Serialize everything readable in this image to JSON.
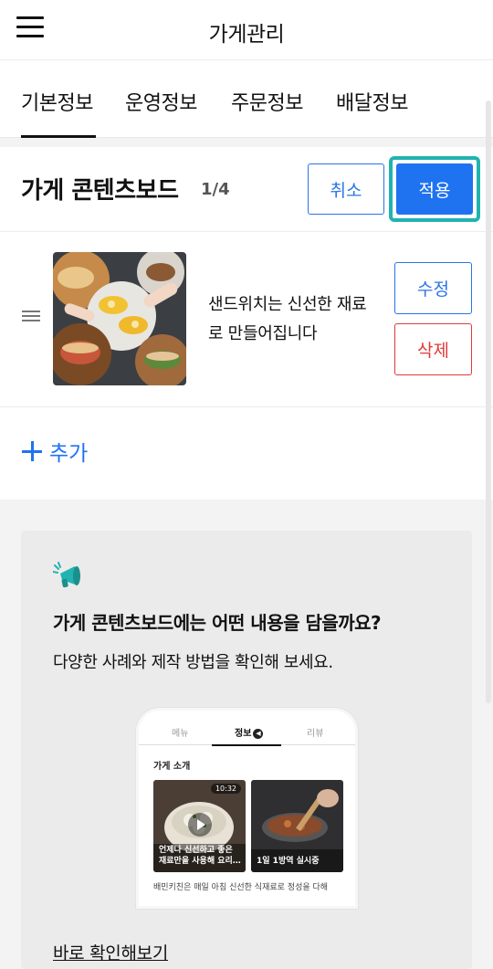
{
  "header": {
    "title": "가게관리",
    "menu_icon": "hamburger-menu-icon"
  },
  "tabs": [
    {
      "label": "기본정보",
      "active": true
    },
    {
      "label": "운영정보",
      "active": false
    },
    {
      "label": "주문정보",
      "active": false
    },
    {
      "label": "배달정보",
      "active": false
    }
  ],
  "board": {
    "title": "가게 콘텐츠보드",
    "count": "1/4",
    "cancel_label": "취소",
    "apply_label": "적용",
    "items": [
      {
        "text": "샌드위치는 신선한 재료로 만들어집니다",
        "edit_label": "수정",
        "delete_label": "삭제"
      }
    ],
    "add_label": "추가"
  },
  "guide": {
    "title": "가게 콘텐츠보드에는 어떤 내용을 담을까요?",
    "subtitle": "다양한 사례와 제작 방법을 확인해 보세요.",
    "link": "바로 확인해보기",
    "preview": {
      "tabs": [
        "메뉴",
        "정보",
        "리뷰"
      ],
      "section": "가게 소개",
      "card1_text": "언제나 신선하고 좋은 재료만을 사용해 요리…",
      "card1_time": "10:32",
      "card2_text": "1일 1방역 실시중",
      "desc": "배민키친은 매일 아침 신선한 식재료로 정성을 다해"
    }
  },
  "colors": {
    "accent": "#1f73f0",
    "danger": "#e03a3a",
    "highlight": "#21b3b0"
  }
}
